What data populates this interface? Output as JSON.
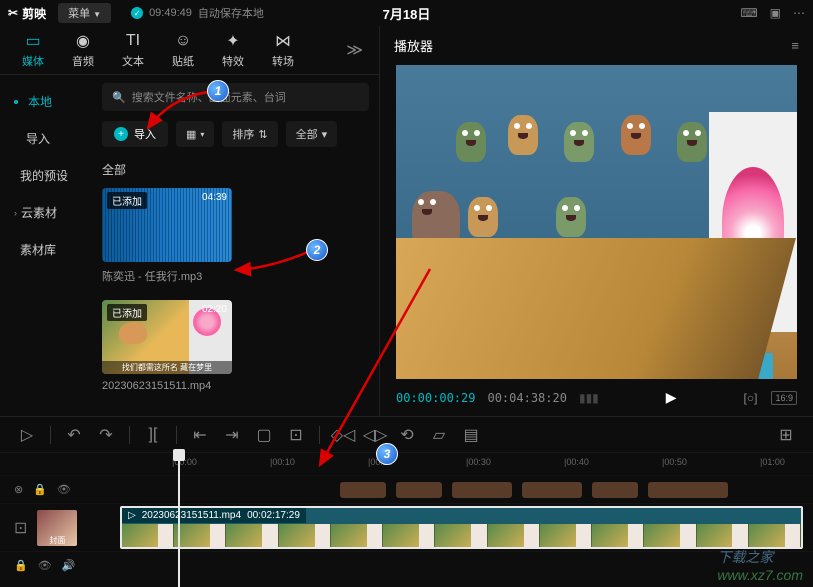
{
  "titlebar": {
    "app_name": "剪映",
    "menu_label": "菜单",
    "save_time": "09:49:49",
    "save_text": "自动保存本地",
    "doc_title": "7月18日"
  },
  "tabs": {
    "media": {
      "label": "媒体"
    },
    "audio": {
      "label": "音频"
    },
    "text": {
      "label": "文本"
    },
    "sticker": {
      "label": "贴纸"
    },
    "effect": {
      "label": "特效"
    },
    "transition": {
      "label": "转场"
    }
  },
  "sidebar": {
    "local": "本地",
    "import": "导入",
    "presets": "我的预设",
    "cloud": "云素材",
    "library": "素材库"
  },
  "media": {
    "search_placeholder": "搜索文件名称、画面元素、台词",
    "import_label": "导入",
    "sort_label": "排序",
    "all_label": "全部",
    "section_all": "全部",
    "items": [
      {
        "badge": "已添加",
        "duration": "04:39",
        "name": "陈奕迅 - 任我行.mp3"
      },
      {
        "badge": "已添加",
        "duration": "02:20",
        "name": "20230623151511.mp4",
        "caption": "找们都需这所名 藏在梦里"
      }
    ]
  },
  "player": {
    "title": "播放器",
    "current": "00:00:00:29",
    "total": "00:04:38:20",
    "ratio": "16:9"
  },
  "timeline": {
    "ticks": [
      "|00:00",
      "|00:10",
      "|00:20",
      "|00:30",
      "|00:40",
      "|00:50",
      "|01:00"
    ],
    "clip_name": "20230623151511.mp4",
    "clip_duration": "00:02:17:29",
    "cover_label": "封面"
  },
  "annotations": {
    "n1": "1",
    "n2": "2",
    "n3": "3"
  },
  "icons": {
    "scissors": "✂",
    "more": "≡",
    "play": "▶",
    "focus": "[○]",
    "grid": "▦",
    "filter": "▼",
    "search": "🔍"
  },
  "watermark": {
    "zh": "下载之家",
    "en": "www.xz7.com"
  }
}
